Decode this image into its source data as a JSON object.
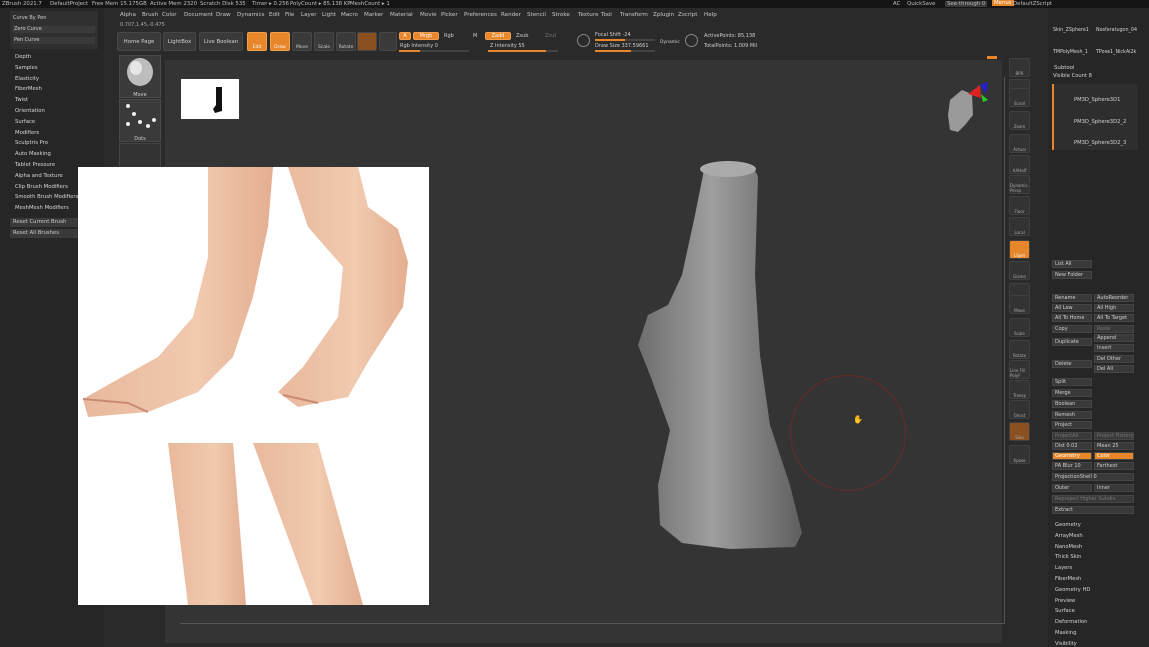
{
  "titlebar": {
    "app": "ZBrush 2021.7",
    "project": "DefaultProject",
    "free_mem": "Free Mem 15.175GB",
    "active_mem": "Active Mem 2320",
    "scratch": "Scratch Disk 535",
    "timer": "Timer ▸ 0.256",
    "polycount": "PolyCount ▸ 85.138 KP",
    "meshcount": "MeshCount ▸ 1",
    "ac": "AC",
    "quicksave": "QuickSave",
    "see_through": "See-through  0",
    "menus": "Menus",
    "script": "DefaultZScript"
  },
  "menu": [
    "Alpha",
    "Brush",
    "Color",
    "Document",
    "Draw",
    "Dynamics",
    "Edit",
    "File",
    "Layer",
    "Light",
    "Macro",
    "Marker",
    "Material",
    "Movie",
    "Picker",
    "Preferences",
    "Render",
    "Stencil",
    "Stroke",
    "Texture",
    "Tool",
    "Transform",
    "Zplugin",
    "Zscript",
    "Help"
  ],
  "toolbar": {
    "home_page": "Home Page",
    "lightbox": "LightBox",
    "live_boolean": "Live Boolean",
    "edit": "Edit",
    "draw": "Draw",
    "move": "Move",
    "scale": "Scale",
    "rotate": "Rotate",
    "a": "A",
    "mrgb": "Mrgb",
    "rgb": "Rgb",
    "m": "M",
    "zadd": "Zadd",
    "zsub": "Zsub",
    "zcut": "Zcut",
    "rgb_intensity": "Rgb Intensity 0",
    "z_intensity": "Z Intensity 55",
    "focal_shift": "Focal Shift -24",
    "draw_size": "Draw Size 337.59661",
    "dynamic": "Dynamic",
    "active_points": "ActivePoints: 85,138",
    "total_points": "TotalPoints: 1.009 Mil",
    "coords": "0.707,1.45,-0.475"
  },
  "left_top": {
    "curve_by_pen": "Curve By Pen",
    "zero_curve": "Zero Curve",
    "pen_curve": "Pen Curve"
  },
  "left_menu": [
    "Depth",
    "Samples",
    "Elasticity",
    "FiberMesh",
    "Twist",
    "Orientation",
    "Surface",
    "Modifiers",
    "Sculptris Pro",
    "Auto Masking",
    "Tablet Pressure",
    "Alpha and Texture",
    "Clip Brush Modifiers",
    "Smooth Brush Modifiers",
    "MeshMesh Modifiers"
  ],
  "reset_current": "Reset Current Brush",
  "reset_all": "Reset All Brushes",
  "brushes": {
    "move": "Move",
    "dots": "Dots"
  },
  "right_tools": {
    "skin": "Skin_ZSphere1",
    "nosferatu": "Nosferatugon_04",
    "polymesh": "TMPolyMesh_1",
    "tpose": "TPose1_NickAi2k",
    "subtool": "Subtool",
    "visible_count": "Visible Count 8",
    "items": [
      "PM3D_Sphere3D1",
      "PM3D_Sphere3D2_2",
      "PM3D_Sphere3D2_3"
    ]
  },
  "subtool_buttons": {
    "list_all": "List All",
    "new_folder": "New Folder",
    "rename": "Rename",
    "auto_reorder": "AutoReorder",
    "all_low": "All Low",
    "all_high": "All High",
    "all_to_home": "All To Home",
    "all_to_target": "All To Target",
    "copy": "Copy",
    "paste": "Paste",
    "duplicate": "Duplicate",
    "append": "Append",
    "insert": "Insert",
    "delete": "Delete",
    "del_other": "Del Other",
    "del_all": "Del All",
    "split": "Split",
    "merge": "Merge",
    "boolean": "Boolean",
    "remesh": "Remesh",
    "project": "Project",
    "projectall": "ProjectAll",
    "project_history": "Project History",
    "dist": "Dist 0.02",
    "mean": "Mean 25",
    "geometry": "Geometry",
    "color": "Color",
    "pa_blur": "PA Blur 10",
    "farthest": "Farthest",
    "projection_shell": "ProjectionShell 0",
    "outer": "Outer",
    "inner": "Inner",
    "reproject": "Reproject Higher Subdiv",
    "extract": "Extract"
  },
  "right_sections": [
    "Geometry",
    "ArrayMesh",
    "NanoMesh",
    "Thick Skin",
    "Layers",
    "FiberMesh",
    "Geometry HD",
    "Preview",
    "Surface",
    "Deformation",
    "Masking",
    "Visibility"
  ],
  "view_buttons": [
    "BPR",
    "SPix 3",
    "Scroll",
    "Zoom",
    "Actual",
    "AAHalf",
    "Dynamic Persp",
    "Floor",
    "Local",
    "LSym",
    "Gizmo",
    "Frame",
    "Move",
    "Scale",
    "Rotate",
    "Line Fill PolyF",
    "Transp",
    "Ghost",
    "Solo",
    "Xpose"
  ],
  "colors": {
    "accent": "#e8862a",
    "bg": "#2a2a2a",
    "panel": "#262626"
  }
}
